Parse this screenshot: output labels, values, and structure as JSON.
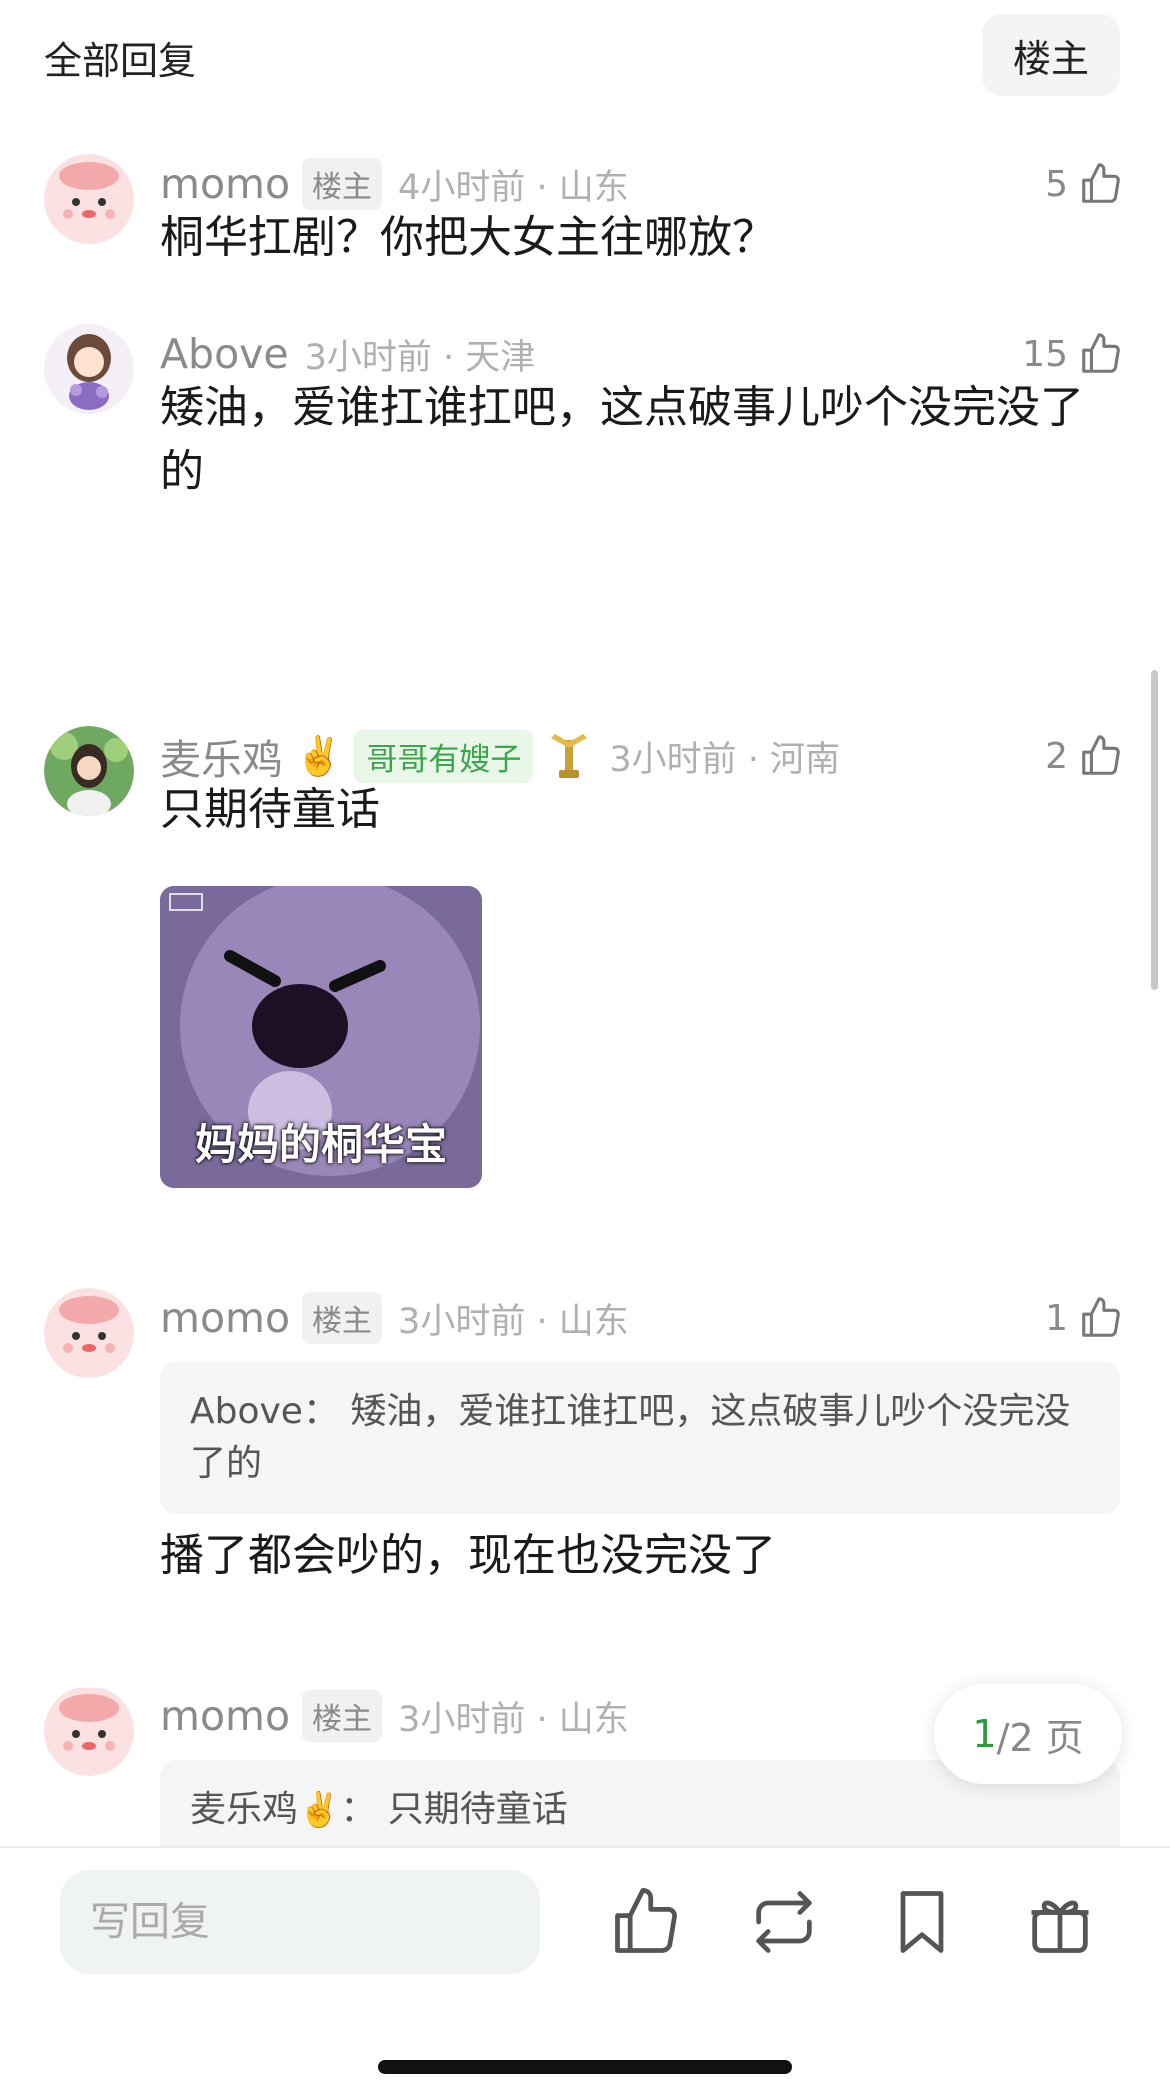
{
  "header": {
    "title": "全部回复",
    "op_button": "楼主"
  },
  "comments": [
    {
      "name": "momo",
      "op_tag": "楼主",
      "time": "4小时前 · 山东",
      "likes": "5",
      "text": "桐华扛剧？你把大女主往哪放？"
    },
    {
      "name": "Above",
      "time": "3小时前 · 天津",
      "likes": "15",
      "text": "矮油，爱谁扛谁扛吧，这点破事儿吵个没完没了的"
    },
    {
      "name": "麦乐鸡",
      "name_emoji": "✌️",
      "fan_badge": "哥哥有嫂子",
      "time": "3小时前 · 河南",
      "likes": "2",
      "text": "只期待童话",
      "sticker_caption": "妈妈的桐华宝"
    },
    {
      "name": "momo",
      "op_tag": "楼主",
      "time": "3小时前 · 山东",
      "likes": "1",
      "quote": "Above：  矮油，爱谁扛谁扛吧，这点破事儿吵个没完没了的",
      "text": "播了都会吵的，现在也没完没了"
    },
    {
      "name": "momo",
      "op_tag": "楼主",
      "time": "3小时前 · 山东",
      "quote_name": "麦乐鸡",
      "quote_emoji": "✌️",
      "quote_text": "：  只期待童话"
    }
  ],
  "pager": {
    "current": "1",
    "total": "/2 页"
  },
  "bottom_bar": {
    "reply_placeholder": "写回复",
    "icons": [
      "like-icon",
      "repost-icon",
      "bookmark-icon",
      "gift-icon"
    ]
  },
  "colors": {
    "accent_green": "#2e9a3e",
    "badge_green": "#3aa54a",
    "muted": "#8a8a8a"
  }
}
